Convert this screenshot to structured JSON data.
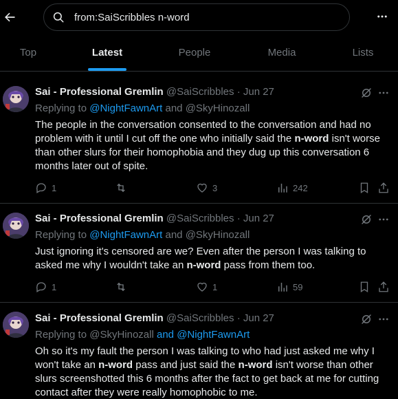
{
  "search": {
    "query": "from:SaiScribbles n-word"
  },
  "tabs": [
    {
      "label": "Top"
    },
    {
      "label": "Latest"
    },
    {
      "label": "People"
    },
    {
      "label": "Media"
    },
    {
      "label": "Lists"
    }
  ],
  "active_tab": "Latest",
  "accent_color": "#1d9bf0",
  "tweets": [
    {
      "name": "Sai - Professional Gremlin",
      "handle": "@SaiScribbles",
      "sep": "·",
      "date": "Jun 27",
      "replying_prefix": "Replying to",
      "reply_a": "@NightFawnArt",
      "reply_and": "and",
      "reply_b": "@SkyHinozall",
      "body": {
        "p1": "The people in the conversation consented to the conversation and had no problem with it until I cut off the one who initially said the ",
        "b1": "n-word",
        "p2": " isn't worse than other slurs for their homophobia and they dug up this conversation 6 months later out of spite."
      },
      "replies": "1",
      "reposts": "",
      "likes": "3",
      "views": "242"
    },
    {
      "name": "Sai - Professional Gremlin",
      "handle": "@SaiScribbles",
      "sep": "·",
      "date": "Jun 27",
      "replying_prefix": "Replying to",
      "reply_a": "@NightFawnArt",
      "reply_and": "and",
      "reply_b": "@SkyHinozall",
      "body": {
        "p1": "Just ignoring it's censored are we? Even after the person I was talking to asked me why I wouldn't take an ",
        "b1": "n-word",
        "p2": " pass from them too."
      },
      "replies": "1",
      "reposts": "",
      "likes": "1",
      "views": "59"
    },
    {
      "name": "Sai - Professional Gremlin",
      "handle": "@SaiScribbles",
      "sep": "·",
      "date": "Jun 27",
      "replying_prefix": "Replying to",
      "reply_a": "@SkyHinozall",
      "reply_and": "and",
      "reply_b": "@NightFawnArt",
      "body": {
        "p1": "Oh so it's my fault the person I was talking to who had just asked me why I won't take an ",
        "b1": "n-word",
        "p2": " pass and just said the ",
        "b2": "n-word",
        "p3": " isn't worse than other slurs screenshotted this 6 months after the fact to get back at me for cutting contact after they were really homophobic to me."
      }
    }
  ],
  "icons": {
    "back": "back-arrow-icon",
    "search": "search-icon",
    "more": "more-icon",
    "grok": "grok-icon",
    "tweet_more": "ellipsis-icon",
    "reply": "reply-icon",
    "repost": "repost-icon",
    "like": "like-icon",
    "views": "views-icon",
    "bookmark": "bookmark-icon",
    "share": "share-icon"
  }
}
